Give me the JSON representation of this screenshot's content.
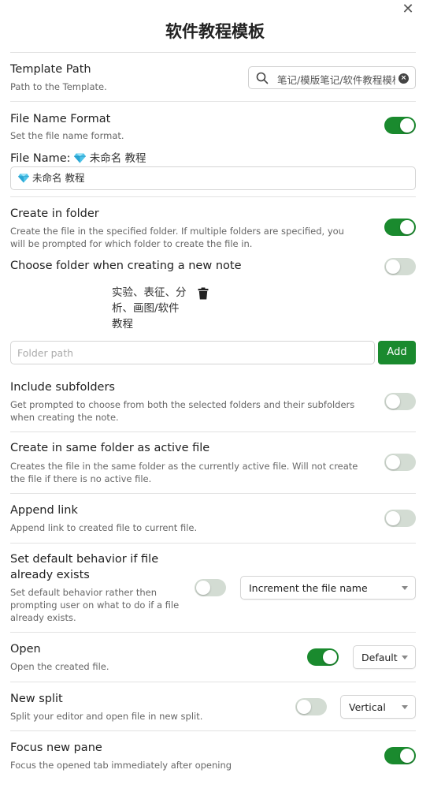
{
  "modal": {
    "title": "软件教程模板",
    "close_glyph": "✕"
  },
  "template_path": {
    "name": "Template Path",
    "desc": "Path to the Template.",
    "value": "笔记/模版笔记/软件教程模板",
    "clear_glyph": "×"
  },
  "file_name_format": {
    "name": "File Name Format",
    "desc": "Set the file name format.",
    "toggle_on": true,
    "preview_label": "File Name:",
    "preview_value": "未命名 教程",
    "field_value": "未命名 教程"
  },
  "create_in_folder": {
    "name": "Create in folder",
    "desc": "Create the file in the specified folder. If multiple folders are specified, you will be prompted for which folder to create the file in.",
    "toggle_on": true
  },
  "choose_folder": {
    "name": "Choose folder when creating a new note",
    "toggle_on": false,
    "folder_item": "实验、表征、分析、画图/软件教程",
    "folder_placeholder": "Folder path",
    "add_label": "Add"
  },
  "include_subfolders": {
    "name": "Include subfolders",
    "desc": "Get prompted to choose from both the selected folders and their subfolders when creating the note.",
    "toggle_on": false
  },
  "same_folder": {
    "name": "Create in same folder as active file",
    "desc": "Creates the file in the same folder as the currently active file. Will not create the file if there is no active file.",
    "toggle_on": false
  },
  "append_link": {
    "name": "Append link",
    "desc": "Append link to created file to current file.",
    "toggle_on": false
  },
  "default_behavior": {
    "name": "Set default behavior if file already exists",
    "desc": "Set default behavior rather then prompting user on what to do if a file already exists.",
    "toggle_on": false,
    "select_value": "Increment the file name"
  },
  "open": {
    "name": "Open",
    "desc": "Open the created file.",
    "toggle_on": true,
    "select_value": "Default"
  },
  "new_split": {
    "name": "New split",
    "desc": "Split your editor and open file in new split.",
    "toggle_on": false,
    "select_value": "Vertical"
  },
  "focus_pane": {
    "name": "Focus new pane",
    "desc": "Focus the opened tab immediately after opening",
    "toggle_on": true
  },
  "colors": {
    "accent": "#1a8a2e",
    "toggle_off": "#d3dcd3"
  },
  "icons": [
    "close-icon",
    "search-icon",
    "clear-icon",
    "gem-icon",
    "trash-icon",
    "chevron-down-icon"
  ]
}
